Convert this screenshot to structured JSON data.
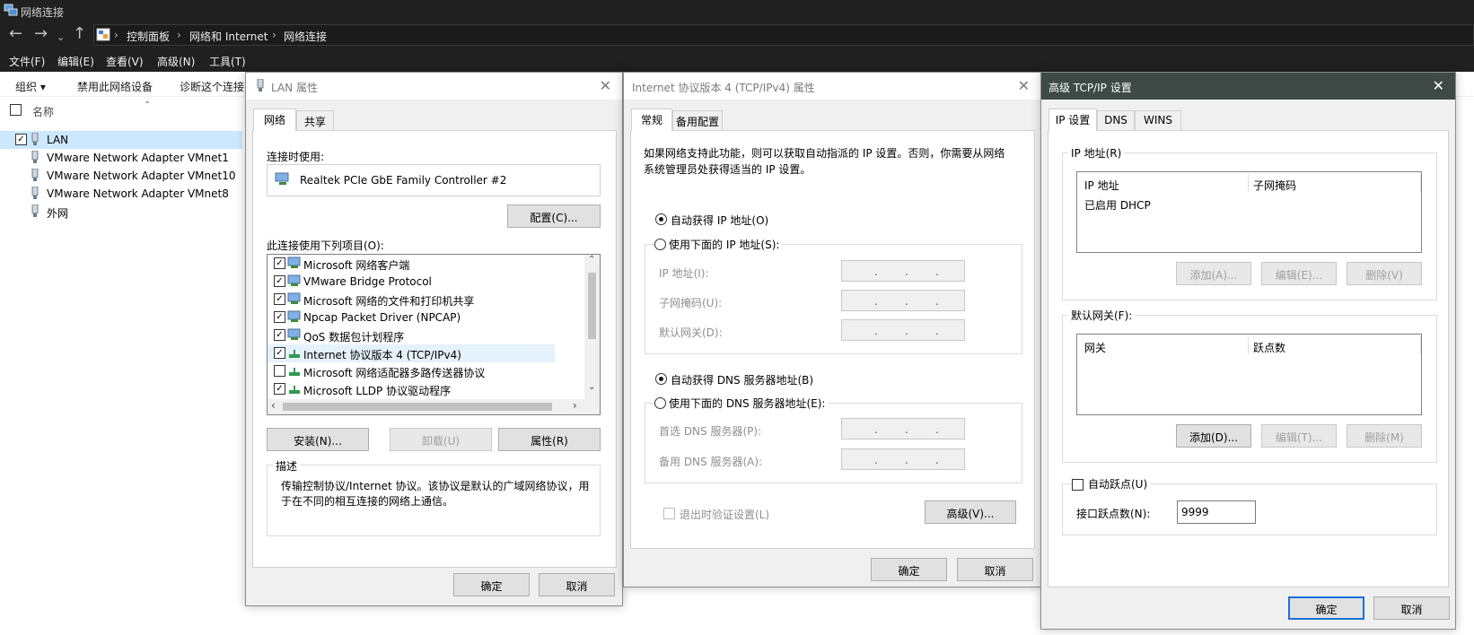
{
  "explorer": {
    "title": "网络连接",
    "breadcrumb": [
      "控制面板",
      "网络和 Internet",
      "网络连接"
    ],
    "menu": [
      "文件(F)",
      "编辑(E)",
      "查看(V)",
      "高级(N)",
      "工具(T)"
    ],
    "commands": [
      "组织 ▾",
      "禁用此网络设备",
      "诊断这个连接"
    ],
    "column_name": "名称",
    "items": [
      "LAN",
      "VMware Network Adapter VMnet1",
      "VMware Network Adapter VMnet10",
      "VMware Network Adapter VMnet8",
      "外网"
    ],
    "selected": "LAN"
  },
  "lan_props": {
    "title": "LAN 属性",
    "tabs": [
      "网络",
      "共享"
    ],
    "connect_using_label": "连接时使用:",
    "adapter": "Realtek PCIe GbE Family Controller #2",
    "configure_button": "配置(C)...",
    "items_label": "此连接使用下列项目(O):",
    "items": [
      {
        "label": "Microsoft 网络客户端",
        "checked": true
      },
      {
        "label": "VMware Bridge Protocol",
        "checked": true
      },
      {
        "label": "Microsoft 网络的文件和打印机共享",
        "checked": true
      },
      {
        "label": "Npcap Packet Driver (NPCAP)",
        "checked": true
      },
      {
        "label": "QoS 数据包计划程序",
        "checked": true
      },
      {
        "label": "Internet 协议版本 4 (TCP/IPv4)",
        "checked": true
      },
      {
        "label": "Microsoft 网络适配器多路传送器协议",
        "checked": false
      },
      {
        "label": "Microsoft LLDP 协议驱动程序",
        "checked": true
      }
    ],
    "install_button": "安装(N)...",
    "uninstall_button": "卸载(U)",
    "properties_button": "属性(R)",
    "description_label": "描述",
    "description": "传输控制协议/Internet 协议。该协议是默认的广域网络协议，用于在不同的相互连接的网络上通信。",
    "ok": "确定",
    "cancel": "取消"
  },
  "ipv4_props": {
    "title": "Internet 协议版本 4 (TCP/IPv4) 属性",
    "tabs": [
      "常规",
      "备用配置"
    ],
    "intro": "如果网络支持此功能，则可以获取自动指派的 IP 设置。否则，你需要从网络系统管理员处获得适当的 IP 设置。",
    "auto_ip": "自动获得 IP 地址(O)",
    "manual_ip": "使用下面的 IP 地址(S):",
    "ip_label": "IP 地址(I):",
    "mask_label": "子网掩码(U):",
    "gateway_label": "默认网关(D):",
    "auto_dns": "自动获得 DNS 服务器地址(B)",
    "manual_dns": "使用下面的 DNS 服务器地址(E):",
    "preferred_dns": "首选 DNS 服务器(P):",
    "alternate_dns": "备用 DNS 服务器(A):",
    "validate_on_exit": "退出时验证设置(L)",
    "advanced_button": "高级(V)...",
    "ok": "确定",
    "cancel": "取消"
  },
  "adv_tcpip": {
    "title": "高级 TCP/IP 设置",
    "tabs": [
      "IP 设置",
      "DNS",
      "WINS"
    ],
    "ip_group": "IP 地址(R)",
    "ip_col1": "IP 地址",
    "ip_col2": "子网掩码",
    "ip_row": "已启用 DHCP",
    "add_button": "添加(A)...",
    "edit_button": "编辑(E)...",
    "delete_button": "删除(V)",
    "gw_group": "默认网关(F):",
    "gw_col1": "网关",
    "gw_col2": "跃点数",
    "gw_add_button": "添加(D)...",
    "gw_edit_button": "编辑(T)...",
    "gw_delete_button": "删除(M)",
    "auto_metric": "自动跃点(U)",
    "interface_metric_label": "接口跃点数(N):",
    "interface_metric_value": "9999",
    "ok": "确定",
    "cancel": "取消"
  }
}
